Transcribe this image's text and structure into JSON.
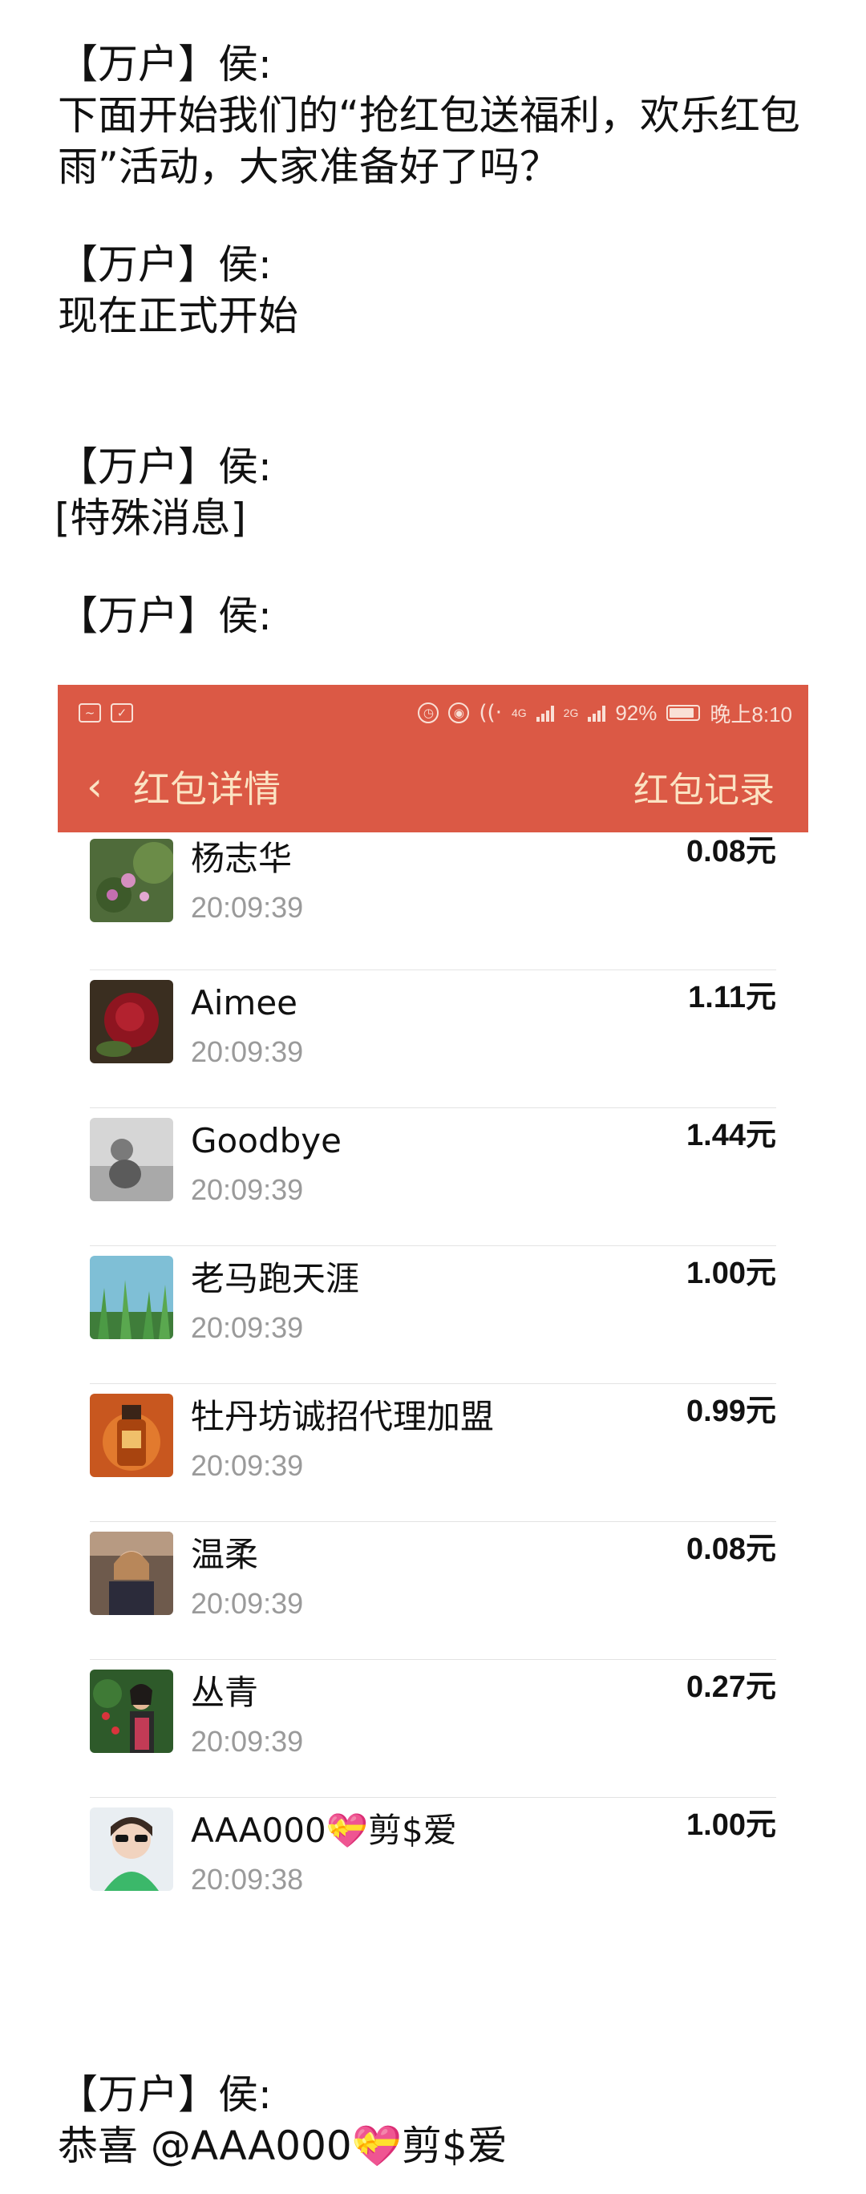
{
  "messages_top": [
    {
      "sender": "【万户】侯:",
      "text": "下面开始我们的“抢红包送福利，欢乐红包雨”活动，大家准备好了吗？"
    },
    {
      "sender": "【万户】侯:",
      "text": "现在正式开始"
    },
    {
      "sender": "【万户】侯:",
      "text": "[特殊消息]"
    },
    {
      "sender": "【万户】侯:",
      "text": ""
    }
  ],
  "screenshot": {
    "status_bar": {
      "battery": "92%",
      "time": "晚上8:10",
      "network_1": "4G",
      "network_2": "2G"
    },
    "nav": {
      "back_icon": "chevron-left-icon",
      "title": "红包详情",
      "record": "红包记录"
    },
    "colors": {
      "header_bg": "#db5945",
      "header_text": "#fbe3c3"
    },
    "recipients": [
      {
        "name": "杨志华",
        "time": "20:09:39",
        "amount": "0.08元",
        "avatar": "flowers-photo"
      },
      {
        "name": "Aimee",
        "time": "20:09:39",
        "amount": "1.11元",
        "avatar": "red-rose-photo"
      },
      {
        "name": "Goodbye",
        "time": "20:09:39",
        "amount": "1.44元",
        "avatar": "grayscale-child-photo"
      },
      {
        "name": "老马跑天涯",
        "time": "20:09:39",
        "amount": "1.00元",
        "avatar": "grass-photo"
      },
      {
        "name": "牡丹坊诚招代理加盟",
        "time": "20:09:39",
        "amount": "0.99元",
        "avatar": "oil-bottle-photo"
      },
      {
        "name": "温柔",
        "time": "20:09:39",
        "amount": "0.08元",
        "avatar": "woman-photo"
      },
      {
        "name": "丛青",
        "time": "20:09:39",
        "amount": "0.27元",
        "avatar": "woman-garden-photo"
      },
      {
        "name": "AAA000💝剪$爱",
        "time": "20:09:38",
        "amount": "1.00元",
        "avatar": "woman-sunglasses-photo"
      }
    ]
  },
  "messages_bottom": [
    {
      "sender": "【万户】侯:",
      "text": "恭喜 @AAA000💝剪$爱"
    }
  ]
}
